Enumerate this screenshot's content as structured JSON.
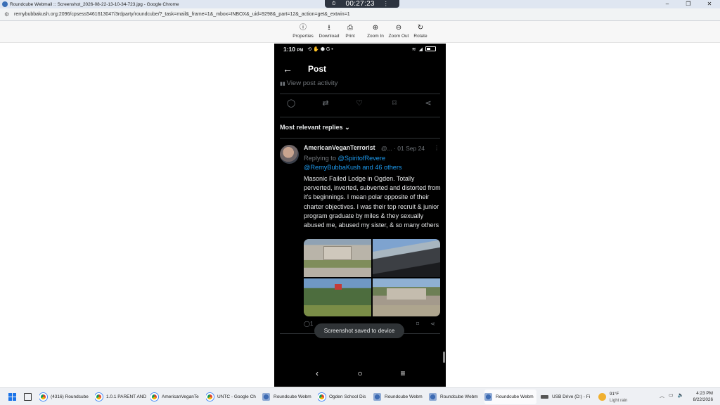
{
  "browser": {
    "window_title": "Roundcube Webmail :: Screenshot_2026-08-22-13-10-34-723.jpg - Google Chrome",
    "url": "remybubbakush.org:2096/cpsess5461613047/3rdparty/roundcube/?_task=mail&_frame=1&_mbox=INBOX&_uid=9298&_part=12&_action=get&_extwin=1",
    "recording_time": "00:27:23",
    "window_controls": [
      "–",
      "❐",
      "✕"
    ]
  },
  "viewer_toolbar": {
    "buttons": [
      {
        "label": "Properties",
        "icon": "info-icon"
      },
      {
        "label": "Download",
        "icon": "download-icon"
      },
      {
        "label": "Print",
        "icon": "print-icon"
      },
      {
        "label": "Zoom In",
        "icon": "zoom-in-icon"
      },
      {
        "label": "Zoom Out",
        "icon": "zoom-out-icon"
      },
      {
        "label": "Rotate",
        "icon": "rotate-icon"
      }
    ]
  },
  "phone": {
    "status_time": "1:10",
    "status_ampm": "PM",
    "header_title": "Post",
    "view_activity": "View post activity",
    "replies_header": "Most relevant replies",
    "reply": {
      "author": "AmericanVeganTerrorist",
      "meta": "@... · 01 Sep 24",
      "replying_prefix": "Replying to",
      "replying_to_1": "@SpiritofRevere",
      "replying_to_2": "@RemyBubbaKush and 46 others",
      "text": "Masonic Failed Lodge in Ogden.  Totally perverted, inverted, subverted and distorted from it's beginnings.  I mean polar opposite of their charter objectives. I was their top recruit & junior program graduate by miles & they sexually abused me, abused my sister, & so many others",
      "reply_count": "1"
    },
    "toast": "Screenshot saved to device"
  },
  "taskbar": {
    "items": [
      {
        "label": "(4316) Roundcube",
        "icon": "chrome"
      },
      {
        "label": "1.0.1 PARENT AND",
        "icon": "chrome"
      },
      {
        "label": "AmericanVeganTe",
        "icon": "chrome"
      },
      {
        "label": "UNTC - Google Ch",
        "icon": "chrome"
      },
      {
        "label": "Roundcube Webm",
        "icon": "rc"
      },
      {
        "label": "Ogden School Dis",
        "icon": "chrome"
      },
      {
        "label": "Roundcube Webm",
        "icon": "rc"
      },
      {
        "label": "Roundcube Webm",
        "icon": "rc"
      },
      {
        "label": "Roundcube Webm",
        "icon": "rc",
        "active": true
      },
      {
        "label": "USB Drive (D:) - Fi",
        "icon": "usb"
      }
    ],
    "weather_temp": "91°F",
    "weather_desc": "Light rain",
    "time": "4:23 PM",
    "date": "8/22/2026"
  }
}
